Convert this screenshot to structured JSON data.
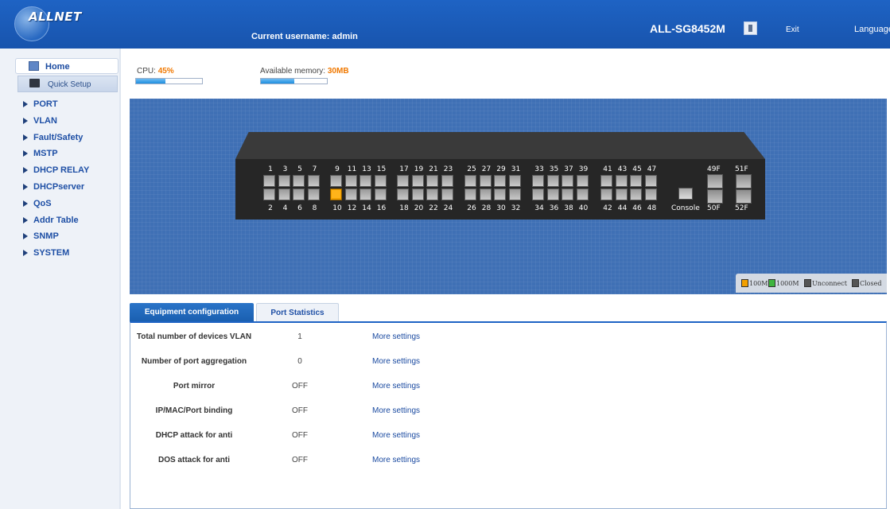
{
  "header": {
    "logo_text": "ALLNET",
    "current_user_label": "Current username:",
    "current_user": "admin",
    "model": "ALL-SG8452M",
    "exit_label": "Exit",
    "language_label": "Language"
  },
  "sidebar": {
    "home_label": "Home",
    "quick_setup_label": "Quick Setup",
    "items": [
      "PORT",
      "VLAN",
      "Fault/Safety",
      "MSTP",
      "DHCP RELAY",
      "DHCPserver",
      "QoS",
      "Addr Table",
      "SNMP",
      "SYSTEM"
    ]
  },
  "status": {
    "cpu_label": "CPU:",
    "cpu_value": "45%",
    "cpu_fraction": 0.45,
    "memory_label": "Available memory:",
    "memory_value": "30MB",
    "memory_fraction": 0.5
  },
  "switch": {
    "top_labels": [
      "1",
      "3",
      "5",
      "7",
      "9",
      "11",
      "13",
      "15",
      "17",
      "19",
      "21",
      "23",
      "25",
      "27",
      "29",
      "31",
      "33",
      "35",
      "37",
      "39",
      "41",
      "43",
      "45",
      "47"
    ],
    "bottom_labels": [
      "2",
      "4",
      "6",
      "8",
      "10",
      "12",
      "14",
      "16",
      "18",
      "20",
      "22",
      "24",
      "26",
      "28",
      "30",
      "32",
      "34",
      "36",
      "38",
      "40",
      "42",
      "44",
      "46",
      "48"
    ],
    "active_port": "10",
    "active_color": "#f2a000",
    "console_label": "Console",
    "sfp_top": [
      "49F",
      "51F"
    ],
    "sfp_bottom": [
      "50F",
      "52F"
    ]
  },
  "legend": [
    {
      "label": "100M",
      "color": "#f2a000"
    },
    {
      "label": "1000M",
      "color": "#3fb53f"
    },
    {
      "label": "Unconnect",
      "color": "#555555"
    },
    {
      "label": "Closed",
      "color": "#555555"
    }
  ],
  "tabs": {
    "equipment": "Equipment configuration",
    "stats": "Port Statistics"
  },
  "rows": [
    {
      "label": "Total number of devices VLAN",
      "value": "1",
      "link": "More settings"
    },
    {
      "label": "Number of port aggregation",
      "value": "0",
      "link": "More settings"
    },
    {
      "label": "Port mirror",
      "value": "OFF",
      "link": "More settings"
    },
    {
      "label": "IP/MAC/Port binding",
      "value": "OFF",
      "link": "More settings"
    },
    {
      "label": "DHCP attack for anti",
      "value": "OFF",
      "link": "More settings"
    },
    {
      "label": "DOS attack for anti",
      "value": "OFF",
      "link": "More settings"
    }
  ]
}
